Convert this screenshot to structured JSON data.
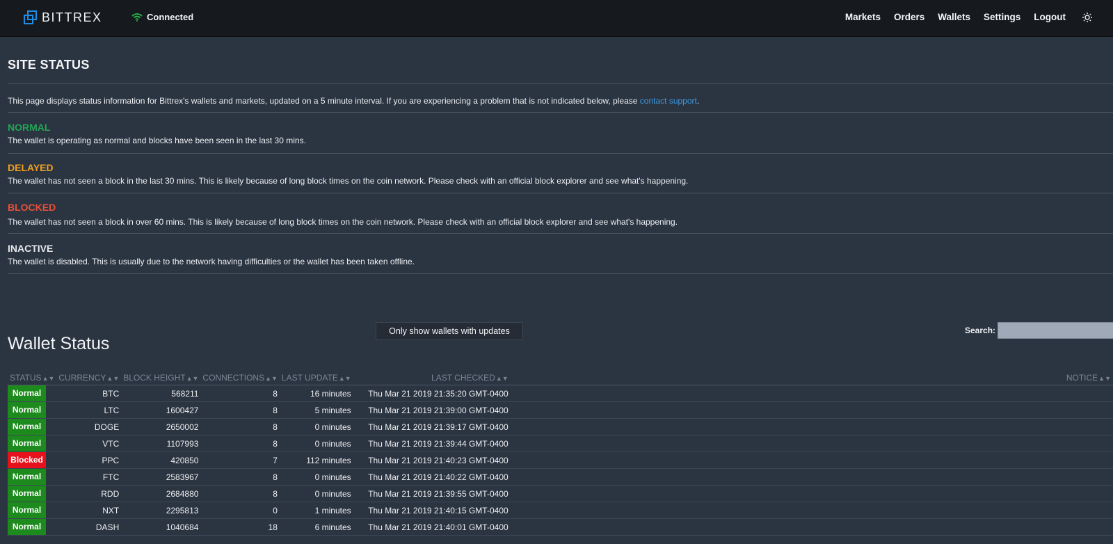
{
  "brand": {
    "name": "BITTREX"
  },
  "connection": {
    "label": "Connected"
  },
  "nav": {
    "markets": "Markets",
    "orders": "Orders",
    "wallets": "Wallets",
    "settings": "Settings",
    "logout": "Logout"
  },
  "site_status": {
    "title": "SITE STATUS",
    "intro_before": "This page displays status information for Bittrex's wallets and markets, updated on a 5 minute interval. If you are experiencing a problem that is not indicated below, please ",
    "intro_link": "contact support",
    "intro_after": ".",
    "legend": [
      {
        "title": "NORMAL",
        "desc": "The wallet is operating as normal and blocks have been seen in the last 30 mins."
      },
      {
        "title": "DELAYED",
        "desc": "The wallet has not seen a block in the last 30 mins. This is likely because of long block times on the coin network. Please check with an official block explorer and see what's happening."
      },
      {
        "title": "BLOCKED",
        "desc": "The wallet has not seen a block in over 60 mins. This is likely because of long block times on the coin network. Please check with an official block explorer and see what's happening."
      },
      {
        "title": "INACTIVE",
        "desc": "The wallet is disabled. This is usually due to the network having difficulties or the wallet has been taken offline."
      }
    ]
  },
  "wallet_status": {
    "title": "Wallet Status",
    "filter_button": "Only show wallets with updates",
    "search_label": "Search:",
    "search_value": "",
    "columns": [
      "STATUS",
      "CURRENCY",
      "BLOCK HEIGHT",
      "CONNECTIONS",
      "LAST UPDATE",
      "LAST CHECKED",
      "NOTICE"
    ],
    "rows": [
      {
        "status": "Normal",
        "currency": "BTC",
        "block_height": "568211",
        "connections": "8",
        "last_update": "16 minutes",
        "last_checked": "Thu Mar 21 2019 21:35:20 GMT-0400",
        "notice": ""
      },
      {
        "status": "Normal",
        "currency": "LTC",
        "block_height": "1600427",
        "connections": "8",
        "last_update": "5 minutes",
        "last_checked": "Thu Mar 21 2019 21:39:00 GMT-0400",
        "notice": ""
      },
      {
        "status": "Normal",
        "currency": "DOGE",
        "block_height": "2650002",
        "connections": "8",
        "last_update": "0 minutes",
        "last_checked": "Thu Mar 21 2019 21:39:17 GMT-0400",
        "notice": ""
      },
      {
        "status": "Normal",
        "currency": "VTC",
        "block_height": "1107993",
        "connections": "8",
        "last_update": "0 minutes",
        "last_checked": "Thu Mar 21 2019 21:39:44 GMT-0400",
        "notice": ""
      },
      {
        "status": "Blocked",
        "currency": "PPC",
        "block_height": "420850",
        "connections": "7",
        "last_update": "112 minutes",
        "last_checked": "Thu Mar 21 2019 21:40:23 GMT-0400",
        "notice": ""
      },
      {
        "status": "Normal",
        "currency": "FTC",
        "block_height": "2583967",
        "connections": "8",
        "last_update": "0 minutes",
        "last_checked": "Thu Mar 21 2019 21:40:22 GMT-0400",
        "notice": ""
      },
      {
        "status": "Normal",
        "currency": "RDD",
        "block_height": "2684880",
        "connections": "8",
        "last_update": "0 minutes",
        "last_checked": "Thu Mar 21 2019 21:39:55 GMT-0400",
        "notice": ""
      },
      {
        "status": "Normal",
        "currency": "NXT",
        "block_height": "2295813",
        "connections": "0",
        "last_update": "1 minutes",
        "last_checked": "Thu Mar 21 2019 21:40:15 GMT-0400",
        "notice": ""
      },
      {
        "status": "Normal",
        "currency": "DASH",
        "block_height": "1040684",
        "connections": "18",
        "last_update": "6 minutes",
        "last_checked": "Thu Mar 21 2019 21:40:01 GMT-0400",
        "notice": ""
      }
    ]
  },
  "colors": {
    "normal": "#1d8a1d",
    "blocked": "#e5121b",
    "link": "#3b99e0",
    "accent": "#1f8ee8"
  }
}
